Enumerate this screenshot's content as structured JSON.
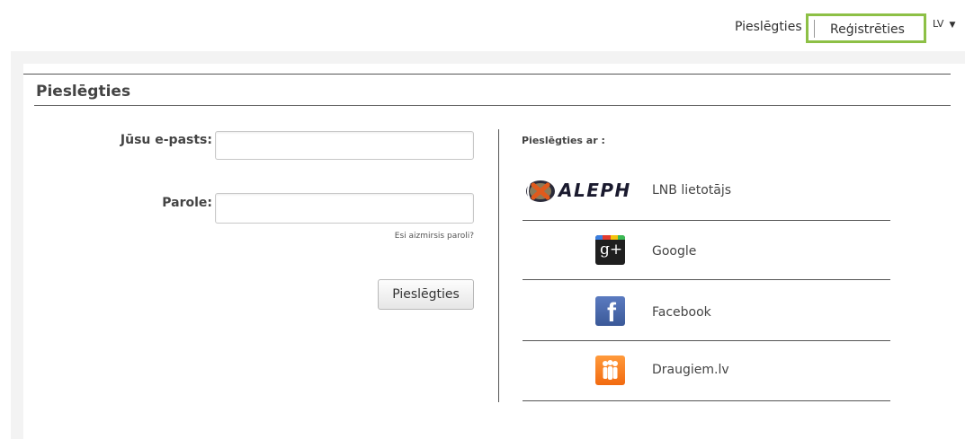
{
  "top": {
    "login": "Pieslēgties",
    "register": "Reģistrēties",
    "lang": "LV",
    "lang_caret": "▼",
    "highlight_color": "#8dc046"
  },
  "panel": {
    "heading": "Pieslēgties"
  },
  "form": {
    "email_label": "Jūsu e-pasts:",
    "email_value": "",
    "password_label": "Parole:",
    "password_value": "",
    "forgot": "Esi aizmirsis paroli?",
    "submit": "Pieslēgties"
  },
  "social": {
    "title": "Pieslēgties ar :",
    "providers": [
      {
        "name": "LNB lietotājs",
        "icon": "aleph-logo",
        "logo_text": "ALEPH"
      },
      {
        "name": "Google",
        "icon": "google-plus-icon",
        "glyph": "g+"
      },
      {
        "name": "Facebook",
        "icon": "facebook-icon",
        "glyph": "f"
      },
      {
        "name": "Draugiem.lv",
        "icon": "draugiem-icon"
      }
    ]
  }
}
